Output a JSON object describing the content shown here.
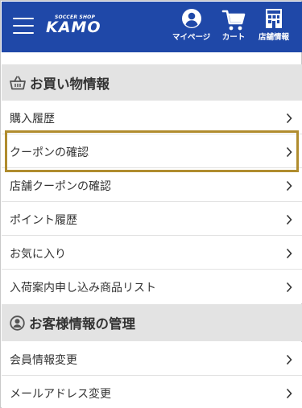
{
  "header": {
    "logo_small": "SOCCER SHOP",
    "logo_main": "KAMO",
    "nav": [
      {
        "label": "マイページ",
        "icon": "account-circle-icon"
      },
      {
        "label": "カート",
        "icon": "cart-icon"
      },
      {
        "label": "店舗情報",
        "icon": "store-icon"
      }
    ],
    "bg_color": "#1f48a8"
  },
  "shopping_section": {
    "title": "お買い物情報",
    "icon": "basket-icon",
    "items": [
      {
        "label": "購入履歴"
      },
      {
        "label": "クーポンの確認",
        "highlighted": true
      },
      {
        "label": "店舗クーポンの確認"
      },
      {
        "label": "ポイント履歴"
      },
      {
        "label": "お気に入り"
      },
      {
        "label": "入荷案内申し込み商品リスト"
      }
    ]
  },
  "customer_section": {
    "title": "お客様情報の管理",
    "icon": "user-circle-icon",
    "items": [
      {
        "label": "会員情報変更"
      },
      {
        "label": "メールアドレス変更"
      }
    ]
  },
  "colors": {
    "section_bg": "#e3e3e3",
    "highlight_border": "#b08c2e"
  }
}
